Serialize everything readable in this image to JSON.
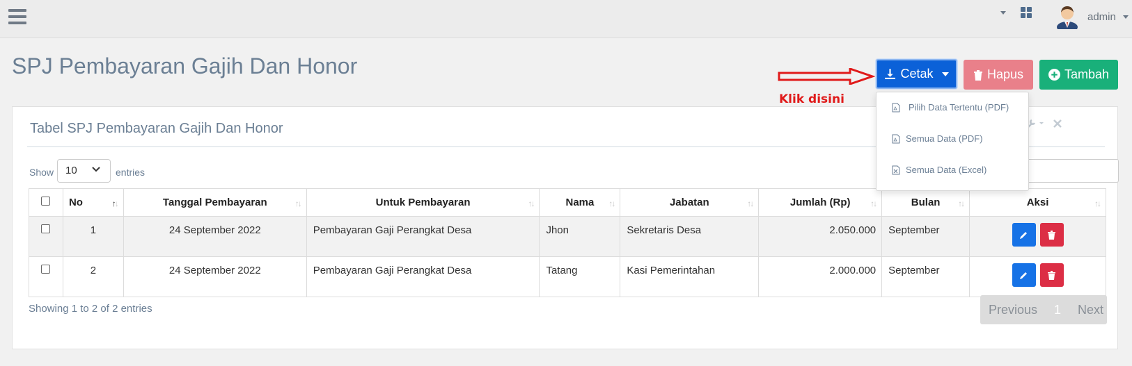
{
  "topbar": {
    "menu_icon": "hamburger-icon",
    "apps_icon": "grid-icon",
    "user": {
      "name": "admin",
      "avatar": "user-avatar"
    }
  },
  "page": {
    "title": "SPJ Pembayaran Gajih Dan Honor"
  },
  "actions": {
    "cetak": "Cetak",
    "hapus": "Hapus",
    "tambah": "Tambah",
    "cetak_menu": [
      "Pilih Data Tertentu (PDF)",
      "Semua Data (PDF)",
      "Semua Data (Excel)"
    ]
  },
  "annotation": {
    "label": "Klik disini",
    "color": "#e01a1a"
  },
  "panel": {
    "title": "Tabel SPJ Pembayaran Gajih Dan Honor",
    "show_label": "Show",
    "entries_value": "10",
    "entries_label": "entries"
  },
  "table": {
    "headers": [
      "No",
      "Tanggal Pembayaran",
      "Untuk Pembayaran",
      "Nama",
      "Jabatan",
      "Jumlah (Rp)",
      "Bulan",
      "Aksi"
    ],
    "rows": [
      {
        "no": "1",
        "tanggal": "24 September 2022",
        "untuk": "Pembayaran Gaji Perangkat Desa",
        "nama": "Jhon",
        "jabatan": "Sekretaris Desa",
        "jumlah": "2.050.000",
        "bulan": "September"
      },
      {
        "no": "2",
        "tanggal": "24 September 2022",
        "untuk": "Pembayaran Gaji Perangkat Desa",
        "nama": "Tatang",
        "jabatan": "Kasi Pemerintahan",
        "jumlah": "2.000.000",
        "bulan": "September"
      }
    ]
  },
  "footer": {
    "showing": "Showing 1 to 2 of 2 entries",
    "previous": "Previous",
    "page": "1",
    "next": "Next"
  },
  "colors": {
    "primary": "#0b61d8",
    "danger_light": "#e9808a",
    "success": "#19b07a",
    "edit": "#1672e6",
    "delete": "#dc2e45"
  }
}
